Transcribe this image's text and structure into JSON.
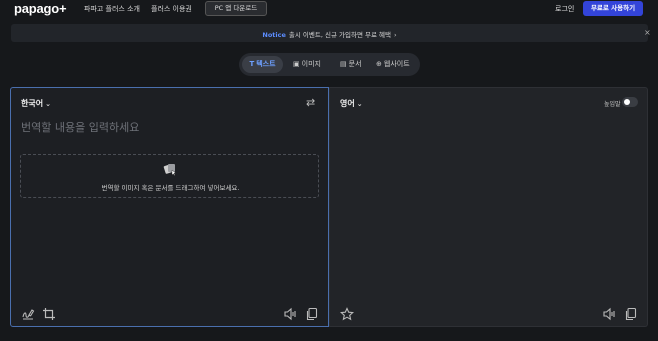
{
  "header": {
    "logo": "papago+",
    "nav": [
      "파파고 플러스 소개",
      "플러스 이용권"
    ],
    "pc_app_button": "PC 앱 다운로드",
    "login": "로그인",
    "free_trial_button": "무료로 사용하기"
  },
  "notice": {
    "tag": "Notice",
    "text": "출시 이벤트, 신규 가입하면 무료 혜택",
    "arrow": "›",
    "close": "×"
  },
  "tabs": [
    {
      "label": "텍스트",
      "icon": "text-icon",
      "glyph": "T",
      "active": true
    },
    {
      "label": "이미지",
      "icon": "image-icon",
      "glyph": "▣",
      "active": false
    },
    {
      "label": "문서",
      "icon": "document-icon",
      "glyph": "▤",
      "active": false
    },
    {
      "label": "웹사이트",
      "icon": "globe-icon",
      "glyph": "⊕",
      "active": false
    }
  ],
  "source": {
    "language": "한국어",
    "placeholder": "번역할 내용을 입력하세요",
    "dropzone_text": "번역할 이미지 혹은 문서를 드래그하여 넣어보세요."
  },
  "target": {
    "language": "영어",
    "honorific_label": "높임말"
  },
  "icons": {
    "chevron": "⌄",
    "swap": "⇄"
  },
  "colors": {
    "accent": "#3344d9",
    "active_tab": "#6ea0ff",
    "notice_tag": "#5c8dff"
  }
}
